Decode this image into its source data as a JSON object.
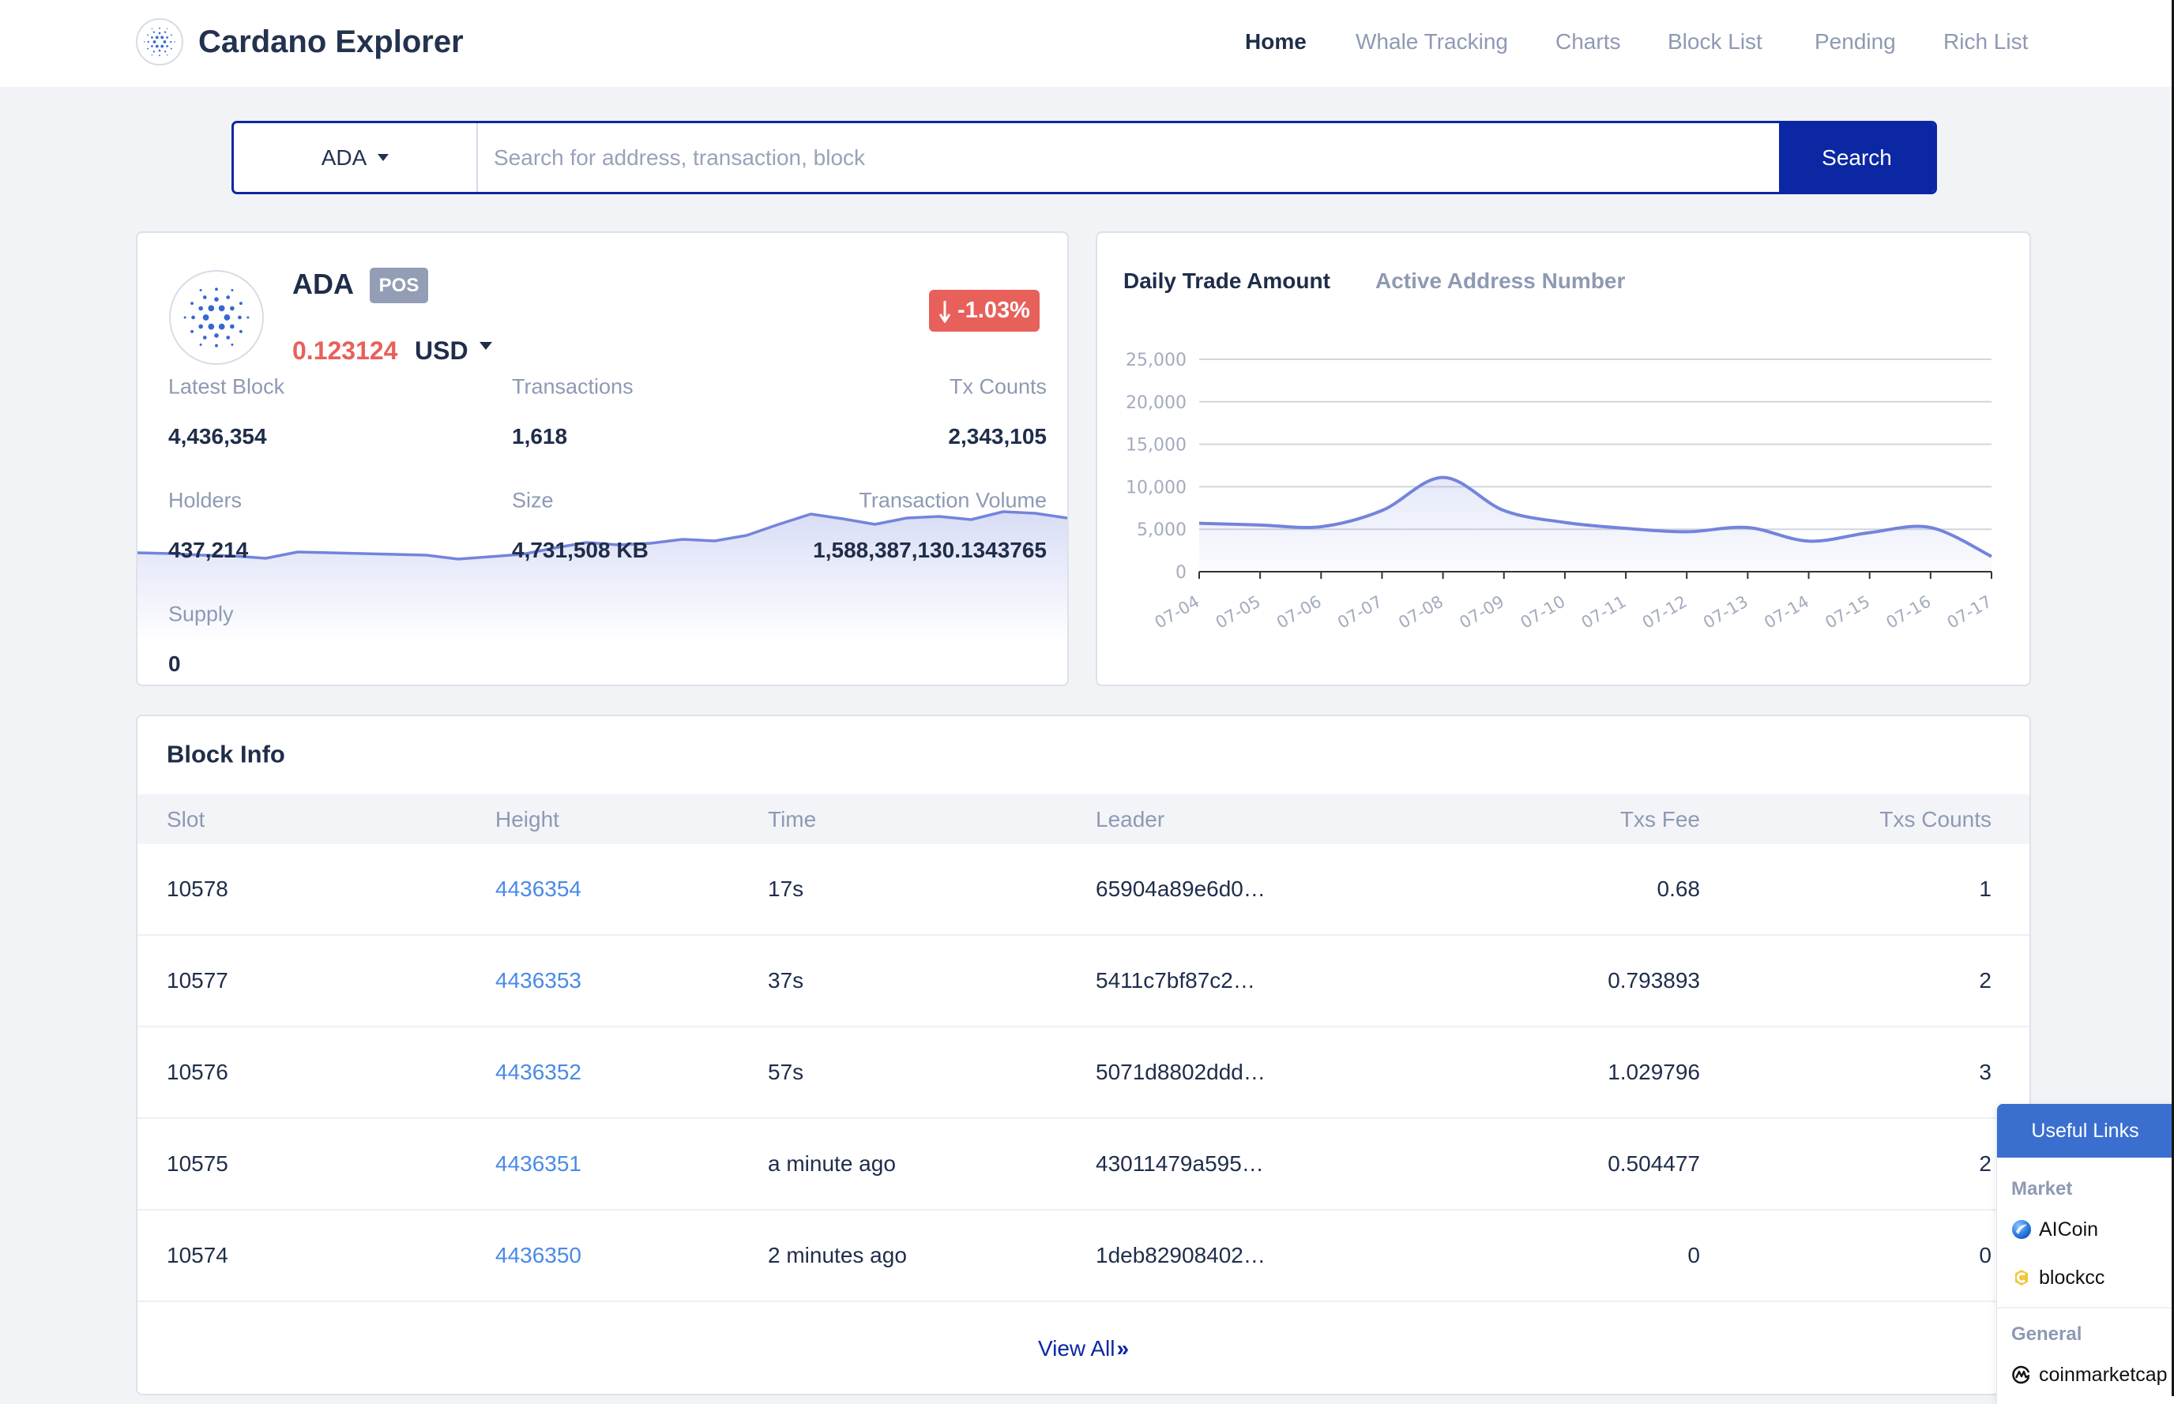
{
  "header": {
    "brand": "Cardano Explorer",
    "nav": [
      {
        "label": "Home",
        "active": true
      },
      {
        "label": "Whale Tracking",
        "active": false
      },
      {
        "label": "Charts",
        "active": false
      },
      {
        "label": "Block List",
        "active": false
      },
      {
        "label": "Pending",
        "active": false
      },
      {
        "label": "Rich List",
        "active": false
      }
    ]
  },
  "search": {
    "currency": "ADA",
    "placeholder": "Search for address, transaction, block",
    "value": "",
    "button": "Search"
  },
  "coin": {
    "symbol": "ADA",
    "consensus_badge": "POS",
    "price": "0.123124",
    "quote_currency": "USD",
    "change": "-1.03%",
    "change_direction": "down"
  },
  "stats": [
    {
      "label": "Latest Block",
      "value": "4,436,354"
    },
    {
      "label": "Transactions",
      "value": "1,618"
    },
    {
      "label": "Tx Counts",
      "value": "2,343,105"
    },
    {
      "label": "Holders",
      "value": "437,214"
    },
    {
      "label": "Size",
      "value": "4,731,508 KB"
    },
    {
      "label": "Transaction Volume",
      "value": "1,588,387,130.1343765"
    },
    {
      "label": "Supply",
      "value": "0"
    }
  ],
  "trade_chart": {
    "tabs": [
      {
        "label": "Daily Trade Amount",
        "active": true
      },
      {
        "label": "Active Address Number",
        "active": false
      }
    ]
  },
  "chart_data": [
    {
      "type": "area",
      "title": "Daily Trade Amount",
      "categories": [
        "07-04",
        "07-05",
        "07-06",
        "07-07",
        "07-08",
        "07-09",
        "07-10",
        "07-11",
        "07-12",
        "07-13",
        "07-14",
        "07-15",
        "07-16",
        "07-17"
      ],
      "series": [
        {
          "name": "Daily Trade Amount",
          "values": [
            5700,
            5500,
            5300,
            7200,
            11100,
            7200,
            5800,
            5100,
            4700,
            5200,
            3600,
            4600,
            5200,
            1800
          ]
        }
      ],
      "xlabel": "",
      "ylabel": "",
      "ylim": [
        0,
        25000
      ],
      "y_ticks": [
        0,
        5000,
        10000,
        15000,
        20000,
        25000
      ],
      "y_tick_labels": [
        "0",
        "5,000",
        "10,000",
        "15,000",
        "20,000",
        "25,000"
      ],
      "grid": true,
      "smooth": true,
      "legend": "none"
    },
    {
      "type": "area",
      "series": [
        {
          "name": "ADA trend",
          "values": [
            20,
            19,
            17,
            16,
            13,
            21,
            20,
            19,
            18,
            17,
            12,
            15,
            18,
            26,
            33,
            30,
            32,
            37,
            35,
            42,
            56,
            69,
            63,
            56,
            64,
            66,
            62,
            72,
            70,
            64
          ]
        }
      ],
      "units": "relative",
      "grid": false,
      "legend": "none"
    }
  ],
  "block_info": {
    "title": "Block Info",
    "columns": [
      "Slot",
      "Height",
      "Time",
      "Leader",
      "Txs Fee",
      "Txs Counts"
    ],
    "rows": [
      {
        "slot": "10578",
        "height": "4436354",
        "time": "17s",
        "leader": "65904a89e6d0…",
        "fee": "0.68",
        "txs": "1"
      },
      {
        "slot": "10577",
        "height": "4436353",
        "time": "37s",
        "leader": "5411c7bf87c2…",
        "fee": "0.793893",
        "txs": "2"
      },
      {
        "slot": "10576",
        "height": "4436352",
        "time": "57s",
        "leader": "5071d8802ddd…",
        "fee": "1.029796",
        "txs": "3"
      },
      {
        "slot": "10575",
        "height": "4436351",
        "time": "a minute ago",
        "leader": "43011479a595…",
        "fee": "0.504477",
        "txs": "2"
      },
      {
        "slot": "10574",
        "height": "4436350",
        "time": "2 minutes ago",
        "leader": "1deb82908402…",
        "fee": "0",
        "txs": "0"
      }
    ],
    "view_all": "View All",
    "view_all_icon": "»"
  },
  "useful_links": {
    "title": "Useful Links",
    "groups": [
      {
        "label": "Market",
        "links": [
          {
            "label": "AICoin",
            "icon": "aicoin-icon"
          },
          {
            "label": "blockcc",
            "icon": "blockcc-icon"
          }
        ]
      },
      {
        "label": "General",
        "links": [
          {
            "label": "coinmarketcap",
            "icon": "coinmarketcap-icon"
          }
        ]
      }
    ]
  },
  "icons": {
    "brand": "cardano-logo-icon",
    "currency_dropdown": "caret-down-icon",
    "price_change": "arrow-down-icon",
    "view_all": "double-chevron-right-icon"
  },
  "colors": {
    "accent": "#0b27a4",
    "link": "#4a8ae6",
    "negative": "#e8605a",
    "badge": "#939db5",
    "chart_line": "#7384dc",
    "cardano_blue": "#3468d1",
    "links_header": "#3a6fd0"
  }
}
